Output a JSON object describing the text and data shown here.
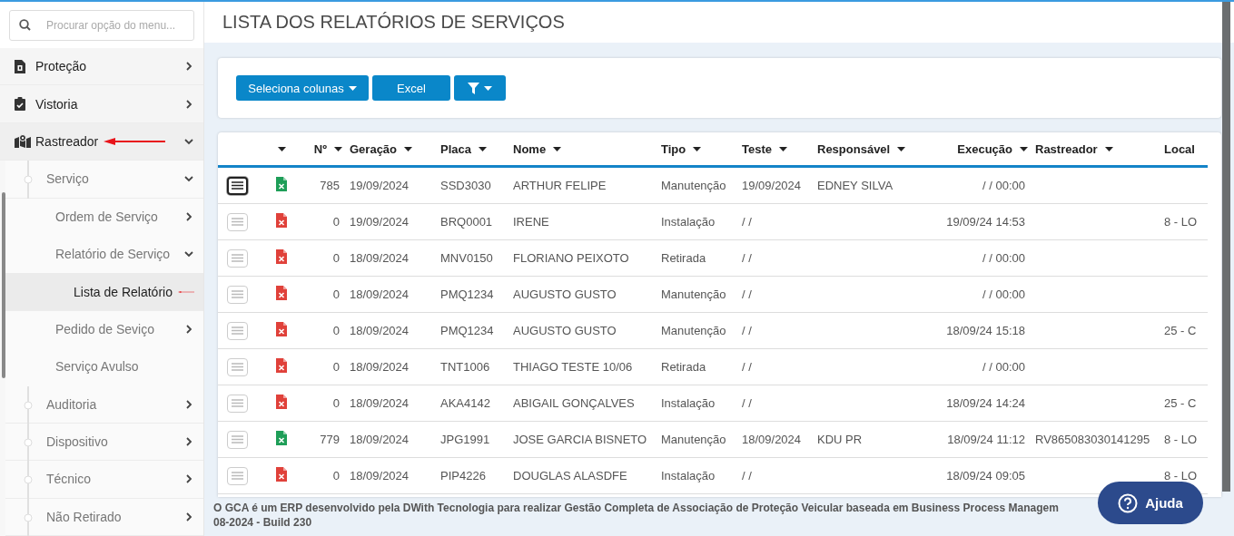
{
  "search": {
    "placeholder": "Procurar opção do menu..."
  },
  "menu": [
    {
      "label": "Proteção",
      "expanded": false,
      "selected": false,
      "arrow": false
    },
    {
      "label": "Vistoria",
      "expanded": false,
      "selected": false,
      "arrow": false
    },
    {
      "label": "Rastreador",
      "expanded": true,
      "selected": false,
      "arrow": true,
      "children": [
        {
          "label": "Serviço",
          "expanded": true,
          "selected": false,
          "arrow": false,
          "children": [
            {
              "label": "Ordem de Serviço",
              "expanded": false,
              "selected": false,
              "arrow": false
            },
            {
              "label": "Relatório de Serviço",
              "expanded": true,
              "selected": false,
              "arrow": false,
              "children": [
                {
                  "label": "Lista de Relatório",
                  "selected": true,
                  "arrow": true
                }
              ]
            },
            {
              "label": "Pedido de Seviço",
              "expanded": false,
              "selected": false,
              "arrow": false
            },
            {
              "label": "Serviço Avulso",
              "selected": false,
              "arrow": false
            }
          ]
        },
        {
          "label": "Auditoria",
          "expanded": false,
          "selected": false,
          "arrow": false
        },
        {
          "label": "Dispositivo",
          "expanded": false,
          "selected": false,
          "arrow": false
        },
        {
          "label": "Técnico",
          "expanded": false,
          "selected": false,
          "arrow": false
        },
        {
          "label": "Não Retirado",
          "expanded": false,
          "selected": false,
          "arrow": false
        }
      ]
    }
  ],
  "page_title": "LISTA DOS RELATÓRIOS DE SERVIÇOS",
  "toolbar": [
    {
      "label": "Seleciona colunas",
      "kind": "dropdown"
    },
    {
      "label": "Excel",
      "kind": "plain"
    },
    {
      "kind": "filter"
    }
  ],
  "table": {
    "columns": [
      "Nº",
      "Geração",
      "Placa",
      "Nome",
      "Tipo",
      "Teste",
      "Responsável",
      "Execução",
      "Rastreador",
      "Local"
    ],
    "rows": [
      {
        "selected": true,
        "color": "#1e9e58",
        "cells": [
          "785",
          "19/09/2024",
          "SSD3030",
          "ARTHUR FELIPE",
          "Manutenção",
          "19/09/2024",
          "EDNEY SILVA",
          "/ / 00:00",
          "",
          ""
        ]
      },
      {
        "selected": false,
        "color": "#e0413a",
        "cells": [
          "0",
          "19/09/2024",
          "BRQ0001",
          "IRENE",
          "Instalação",
          "/ /",
          "",
          "19/09/24 14:53",
          "",
          "8 - LO"
        ]
      },
      {
        "selected": false,
        "color": "#e0413a",
        "cells": [
          "0",
          "18/09/2024",
          "MNV0150",
          "FLORIANO PEIXOTO",
          "Retirada",
          "/ /",
          "",
          "/ / 00:00",
          "",
          ""
        ]
      },
      {
        "selected": false,
        "color": "#e0413a",
        "cells": [
          "0",
          "18/09/2024",
          "PMQ1234",
          "AUGUSTO GUSTO",
          "Manutenção",
          "/ /",
          "",
          "/ / 00:00",
          "",
          ""
        ]
      },
      {
        "selected": false,
        "color": "#e0413a",
        "cells": [
          "0",
          "18/09/2024",
          "PMQ1234",
          "AUGUSTO GUSTO",
          "Manutenção",
          "/ /",
          "",
          "18/09/24 15:18",
          "",
          "25 - C"
        ]
      },
      {
        "selected": false,
        "color": "#e0413a",
        "cells": [
          "0",
          "18/09/2024",
          "TNT1006",
          "THIAGO TESTE 10/06",
          "Retirada",
          "/ /",
          "",
          "/ / 00:00",
          "",
          ""
        ]
      },
      {
        "selected": false,
        "color": "#e0413a",
        "cells": [
          "0",
          "18/09/2024",
          "AKA4142",
          "ABIGAIL GONÇALVES",
          "Instalação",
          "/ /",
          "",
          "18/09/24 14:24",
          "",
          "25 - C"
        ]
      },
      {
        "selected": false,
        "color": "#1e9e58",
        "cells": [
          "779",
          "18/09/2024",
          "JPG1991",
          "JOSE GARCIA BISNETO",
          "Manutenção",
          "18/09/2024",
          "KDU PR",
          "18/09/24 11:12",
          "RV865083030141295",
          "8 - LO"
        ]
      },
      {
        "selected": false,
        "color": "#e0413a",
        "cells": [
          "0",
          "18/09/2024",
          "PIP4226",
          "DOUGLAS ALASDFE",
          "Instalação",
          "/ /",
          "",
          "18/09/24 09:05",
          "",
          "8 - LO"
        ]
      }
    ]
  },
  "footer": [
    "O GCA é um ERP desenvolvido pela DWith Tecnologia para realizar Gestão Completa de Associação de Proteção Veicular baseada em Business Process Managem",
    "08-2024 - Build 230"
  ],
  "help_button": "Ajuda"
}
